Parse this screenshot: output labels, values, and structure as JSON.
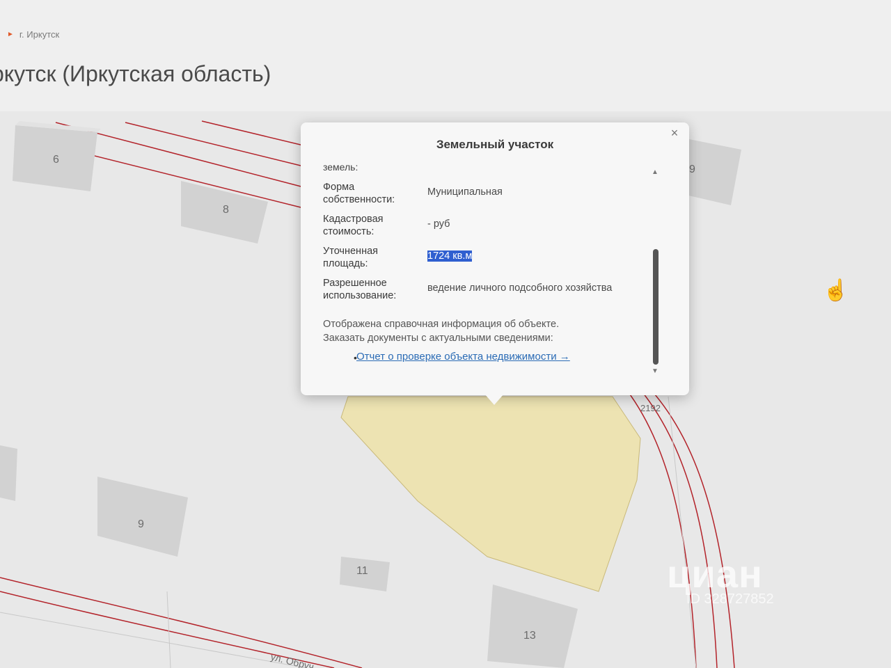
{
  "breadcrumb": {
    "item": "г. Иркутск"
  },
  "page_title": "ркутск (Иркутская область)",
  "map": {
    "houses": [
      "6",
      "8",
      "9",
      "9",
      "11",
      "13"
    ],
    "parcel_number": "2192",
    "street_label": "ул. Обруч"
  },
  "popup": {
    "title": "Земельный участок",
    "close_symbol": "×",
    "cut_text": "земель:",
    "rows": [
      {
        "label": "Форма собственности:",
        "value": "Муниципальная"
      },
      {
        "label": "Кадастровая стоимость:",
        "value": "- руб"
      },
      {
        "label": "Уточненная площадь:",
        "value": "1724 кв.м"
      },
      {
        "label": "Разрешенное использование:",
        "value": "ведение личного подсобного хозяйства"
      }
    ],
    "info_text_1": "Отображена справочная информация об объекте.",
    "info_text_2": "Заказать документы с актуальными сведениями:",
    "link": "Отчет о проверке объекта недвижимости →"
  },
  "watermark": {
    "brand": "циан",
    "id": "ID 328727852"
  },
  "colors": {
    "parcel_fill": "#ede3b2",
    "boundary_line": "#b3232a",
    "link": "#2a6bb5",
    "selection": "#2f5fd0"
  }
}
